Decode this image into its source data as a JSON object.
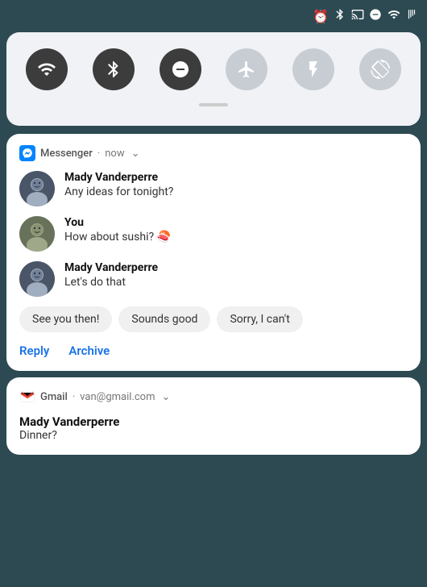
{
  "statusBar": {
    "icons": [
      "alarm",
      "bluetooth",
      "cast",
      "dnd",
      "wifi",
      "signal"
    ]
  },
  "quickSettings": {
    "icons": [
      {
        "name": "wifi",
        "active": true
      },
      {
        "name": "bluetooth",
        "active": true
      },
      {
        "name": "dnd",
        "active": true
      },
      {
        "name": "airplane",
        "active": false
      },
      {
        "name": "flashlight",
        "active": false
      },
      {
        "name": "rotate",
        "active": false
      }
    ]
  },
  "messengerNotif": {
    "appName": "Messenger",
    "time": "now",
    "messages": [
      {
        "sender": "Mady Vanderperre",
        "text": "Any ideas for tonight?",
        "isYou": false
      },
      {
        "sender": "You",
        "text": "How about sushi? 🍣",
        "isYou": true
      },
      {
        "sender": "Mady Vanderperre",
        "text": "Let's do that",
        "isYou": false
      }
    ],
    "quickReplies": [
      "See you then!",
      "Sounds good",
      "Sorry, I can't"
    ],
    "actions": [
      "Reply",
      "Archive"
    ]
  },
  "gmailNotif": {
    "appName": "Gmail",
    "account": "van@gmail.com",
    "sender": "Mady Vanderperre",
    "subject": "Dinner?"
  }
}
